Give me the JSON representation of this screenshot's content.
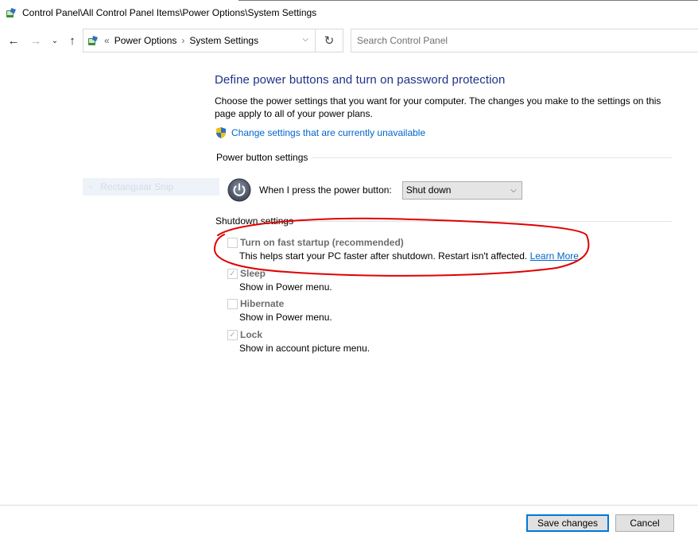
{
  "window": {
    "title": "Control Panel\\All Control Panel Items\\Power Options\\System Settings"
  },
  "nav": {
    "back_icon": "back-arrow-icon",
    "forward_icon": "forward-arrow-icon",
    "recent_icon": "chevron-down-icon",
    "up_icon": "up-arrow-icon",
    "overflow": "«",
    "breadcrumbs": [
      "Power Options",
      "System Settings"
    ],
    "search_placeholder": "Search Control Panel"
  },
  "main": {
    "title": "Define power buttons and turn on password protection",
    "description": "Choose the power settings that you want for your computer. The changes you make to the settings on this page apply to all of your power plans.",
    "change_settings_link": "Change settings that are currently unavailable",
    "power_button_section": "Power button settings",
    "power_button_label": "When I press the power button:",
    "power_button_value": "Shut down",
    "shutdown_section": "Shutdown settings",
    "options": [
      {
        "name": "Turn on fast startup (recommended)",
        "desc": "This helps start your PC faster after shutdown. Restart isn't affected.",
        "link": "Learn More",
        "checked": false
      },
      {
        "name": "Sleep",
        "desc": "Show in Power menu.",
        "checked": true
      },
      {
        "name": "Hibernate",
        "desc": "Show in Power menu.",
        "checked": false
      },
      {
        "name": "Lock",
        "desc": "Show in account picture menu.",
        "checked": true
      }
    ]
  },
  "overlay": {
    "snip_label": "Rectangular Snip"
  },
  "footer": {
    "save_label": "Save changes",
    "cancel_label": "Cancel"
  },
  "colors": {
    "title_blue": "#1e3287",
    "link_blue": "#0066cc",
    "annotation_red": "#e00000",
    "button_focus": "#0078d7"
  }
}
